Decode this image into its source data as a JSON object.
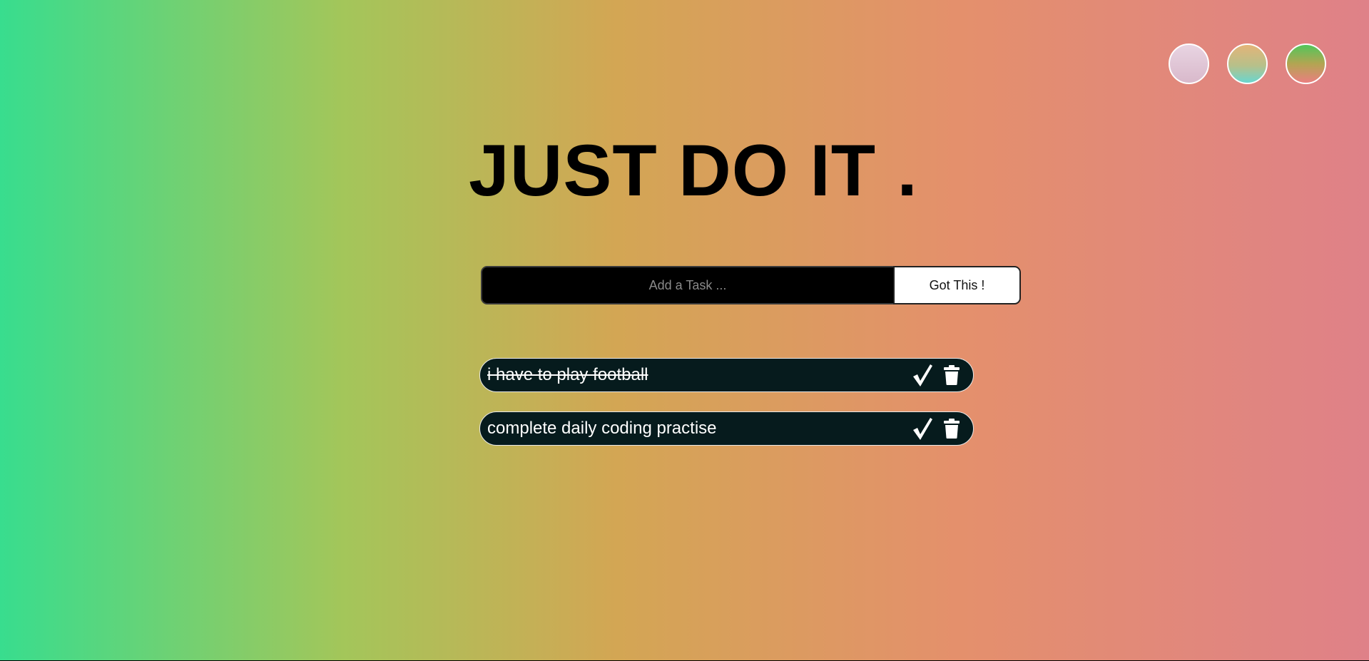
{
  "page": {
    "title": "JUST DO IT ."
  },
  "theme_switcher": {
    "themes": [
      {
        "name": "light",
        "color_top": "#e8d4e2",
        "color_bottom": "#d9b9cb"
      },
      {
        "name": "sunset",
        "color_top": "#e3b478",
        "color_bottom": "#69d6cf"
      },
      {
        "name": "green-rose",
        "color_top": "#52c65a",
        "color_bottom": "#ea7f80"
      }
    ]
  },
  "form": {
    "input_placeholder": "Add a Task ...",
    "input_value": "",
    "button_label": "Got This !"
  },
  "todos": [
    {
      "text": "i have to play football",
      "completed": true
    },
    {
      "text": "complete daily coding practise",
      "completed": false
    }
  ],
  "colors": {
    "gradient_start": "#38dd8e",
    "gradient_end": "#df8188",
    "todo_background": "#061b1d",
    "input_background": "#000000"
  },
  "icons": {
    "check": "check-icon",
    "delete": "trash-icon"
  }
}
